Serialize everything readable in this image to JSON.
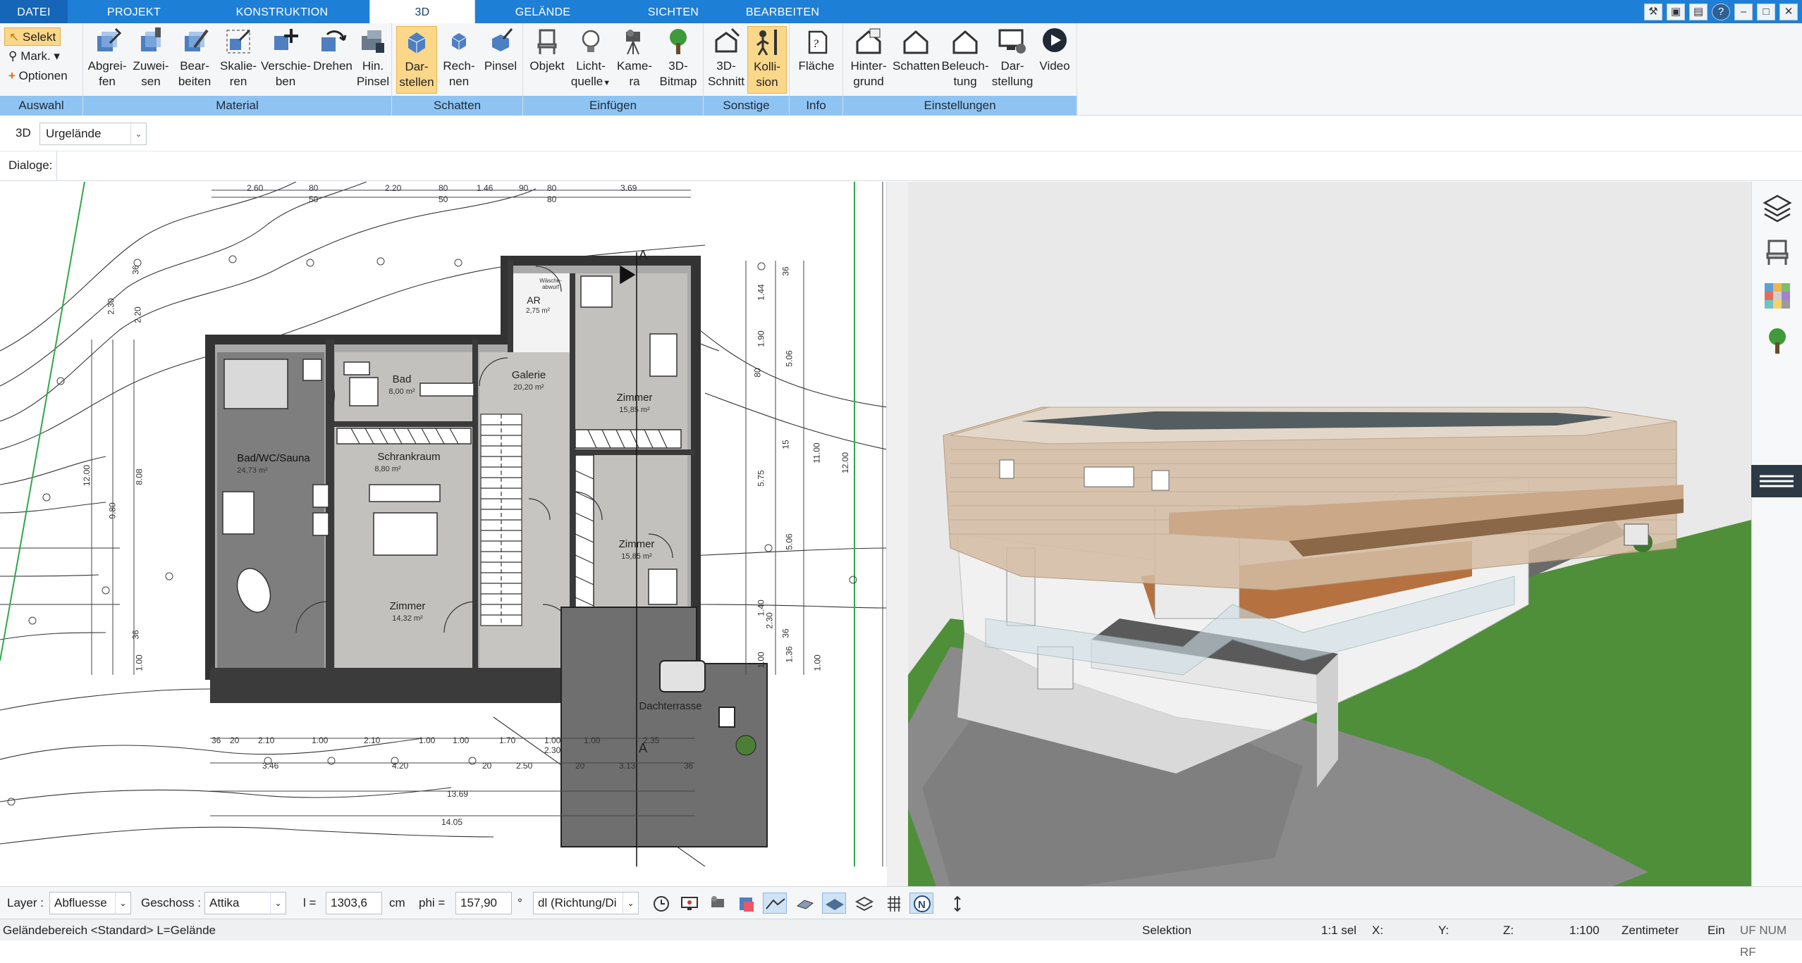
{
  "tabs": [
    "DATEI",
    "PROJEKT",
    "KONSTRUKTION",
    "3D",
    "GELÄNDE",
    "SICHTEN",
    "BEARBEITEN"
  ],
  "active_tab": "3D",
  "window_controls": [
    "tools-icon",
    "restore-icon",
    "layout-icon",
    "help-icon",
    "minimize-icon",
    "maximize-icon",
    "close-icon"
  ],
  "ribbon": {
    "auswahl": {
      "label": "Auswahl",
      "selekt": "Selekt",
      "mark": "Mark.",
      "optionen": "Optionen"
    },
    "material": {
      "label": "Material",
      "buttons": [
        "Abgrei-\nfen",
        "Zuwei-\nsen",
        "Bear-\nbeiten",
        "Skalie-\nren",
        "Verschie-\nben",
        "Drehen",
        "Hin.\nPinsel"
      ]
    },
    "schatten": {
      "label": "Schatten",
      "buttons": [
        "Dar-\nstellen",
        "Rech-\nnen",
        "Pinsel"
      ]
    },
    "einfuegen": {
      "label": "Einfügen",
      "buttons": [
        "Objekt",
        "Licht-\nquelle",
        "Kame-\nra",
        "3D-\nBitmap"
      ]
    },
    "sonstige": {
      "label": "Sonstige",
      "buttons": [
        "3D-\nSchnitt",
        "Kolli-\nsion"
      ]
    },
    "info": {
      "label": "Info",
      "buttons": [
        "Fläche"
      ]
    },
    "einstellungen": {
      "label": "Einstellungen",
      "buttons": [
        "Hinter-\ngrund",
        "Schatten",
        "Beleuch-\ntung",
        "Dar-\nstellung",
        "Video"
      ]
    }
  },
  "toolbar": {
    "mode": "3D",
    "terrain_select": "Urgelände",
    "dialoge_label": "Dialoge:"
  },
  "plan": {
    "rooms": [
      {
        "name": "Bad",
        "area": "8,00 m²"
      },
      {
        "name": "Galerie",
        "area": "20,20 m²"
      },
      {
        "name": "Zimmer",
        "area": "15,85 m²"
      },
      {
        "name": "Bad/WC/Sauna",
        "area": "24,73 m²"
      },
      {
        "name": "Schrankraum",
        "area": "8,80 m²"
      },
      {
        "name": "Zimmer",
        "area": "15,85 m²"
      },
      {
        "name": "Zimmer",
        "area": "14,32 m²"
      },
      {
        "name": "AR",
        "area": "2,75 m²"
      },
      {
        "name": "Dachterrasse",
        "area": ""
      }
    ],
    "laundry_label": "Wäsche-\nabwurf",
    "section_marker": "A",
    "dims_top": [
      "2.60",
      "80",
      "2.20",
      "80",
      "1.46",
      "90",
      "80",
      "3.69"
    ],
    "dims_top_sub": [
      "50",
      "50",
      "80"
    ],
    "dims_bottom_row1": [
      "36",
      "20",
      "2.10",
      "1.00",
      "2.10",
      "1.00",
      "1.00",
      "1.70",
      "1.00",
      "1.00"
    ],
    "dims_bottom_row2": [
      "3.46",
      "4.20",
      "20",
      "2.50",
      "20",
      "3.13",
      "36"
    ],
    "dims_bottom_total1": "13.69",
    "dims_bottom_total2": "14.05",
    "dims_bottom_misc": [
      "2.30",
      "2.35"
    ],
    "dims_left": [
      "2.30",
      "2.20",
      "36",
      "12.00",
      "9.80",
      "8.08",
      "36",
      "1.00"
    ],
    "dims_right": [
      "1.44",
      "36",
      "1.90",
      "80",
      "5.06",
      "15",
      "11.00",
      "12.00",
      "5.75",
      "5.06",
      "1.40",
      "2.30",
      "1.00",
      "36",
      "1.36",
      "1.00"
    ]
  },
  "bottom": {
    "layer_label": "Layer :",
    "layer_value": "Abfluesse",
    "geschoss_label": "Geschoss :",
    "geschoss_value": "Attika",
    "l_label": "l =",
    "l_value": "1303,6",
    "l_unit": "cm",
    "phi_label": "phi =",
    "phi_value": "157,90",
    "phi_unit": "°",
    "dl_value": "dl (Richtung/Di"
  },
  "status": {
    "left": "Geländebereich <Standard> L=Gelände",
    "mode": "Selektion",
    "sel": "1:1 sel",
    "x": "X:",
    "y": "Y:",
    "z": "Z:",
    "scale": "1:100",
    "unit": "Zentimeter",
    "ein": "Ein",
    "flags": "UF NUM RF"
  },
  "colors": {
    "accent": "#1e7fd6",
    "group_label": "#8fc4f2",
    "active_btn": "#fbd78a",
    "grass": "#4f8f3a",
    "wall": "#3b3b3b"
  }
}
